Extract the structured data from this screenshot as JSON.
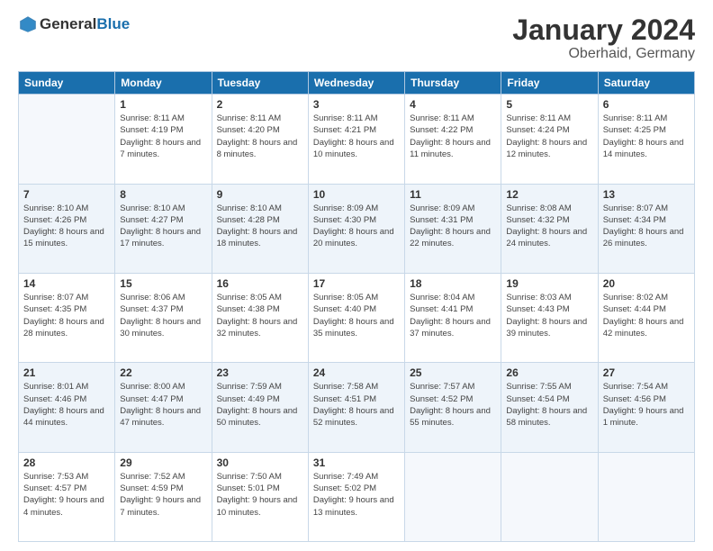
{
  "header": {
    "logo_general": "General",
    "logo_blue": "Blue",
    "title": "January 2024",
    "subtitle": "Oberhaid, Germany"
  },
  "calendar": {
    "days_of_week": [
      "Sunday",
      "Monday",
      "Tuesday",
      "Wednesday",
      "Thursday",
      "Friday",
      "Saturday"
    ],
    "weeks": [
      [
        {
          "num": "",
          "empty": true
        },
        {
          "num": "1",
          "sunrise": "8:11 AM",
          "sunset": "4:19 PM",
          "daylight": "8 hours and 7 minutes."
        },
        {
          "num": "2",
          "sunrise": "8:11 AM",
          "sunset": "4:20 PM",
          "daylight": "8 hours and 8 minutes."
        },
        {
          "num": "3",
          "sunrise": "8:11 AM",
          "sunset": "4:21 PM",
          "daylight": "8 hours and 10 minutes."
        },
        {
          "num": "4",
          "sunrise": "8:11 AM",
          "sunset": "4:22 PM",
          "daylight": "8 hours and 11 minutes."
        },
        {
          "num": "5",
          "sunrise": "8:11 AM",
          "sunset": "4:24 PM",
          "daylight": "8 hours and 12 minutes."
        },
        {
          "num": "6",
          "sunrise": "8:11 AM",
          "sunset": "4:25 PM",
          "daylight": "8 hours and 14 minutes."
        }
      ],
      [
        {
          "num": "7",
          "sunrise": "8:10 AM",
          "sunset": "4:26 PM",
          "daylight": "8 hours and 15 minutes."
        },
        {
          "num": "8",
          "sunrise": "8:10 AM",
          "sunset": "4:27 PM",
          "daylight": "8 hours and 17 minutes."
        },
        {
          "num": "9",
          "sunrise": "8:10 AM",
          "sunset": "4:28 PM",
          "daylight": "8 hours and 18 minutes."
        },
        {
          "num": "10",
          "sunrise": "8:09 AM",
          "sunset": "4:30 PM",
          "daylight": "8 hours and 20 minutes."
        },
        {
          "num": "11",
          "sunrise": "8:09 AM",
          "sunset": "4:31 PM",
          "daylight": "8 hours and 22 minutes."
        },
        {
          "num": "12",
          "sunrise": "8:08 AM",
          "sunset": "4:32 PM",
          "daylight": "8 hours and 24 minutes."
        },
        {
          "num": "13",
          "sunrise": "8:07 AM",
          "sunset": "4:34 PM",
          "daylight": "8 hours and 26 minutes."
        }
      ],
      [
        {
          "num": "14",
          "sunrise": "8:07 AM",
          "sunset": "4:35 PM",
          "daylight": "8 hours and 28 minutes."
        },
        {
          "num": "15",
          "sunrise": "8:06 AM",
          "sunset": "4:37 PM",
          "daylight": "8 hours and 30 minutes."
        },
        {
          "num": "16",
          "sunrise": "8:05 AM",
          "sunset": "4:38 PM",
          "daylight": "8 hours and 32 minutes."
        },
        {
          "num": "17",
          "sunrise": "8:05 AM",
          "sunset": "4:40 PM",
          "daylight": "8 hours and 35 minutes."
        },
        {
          "num": "18",
          "sunrise": "8:04 AM",
          "sunset": "4:41 PM",
          "daylight": "8 hours and 37 minutes."
        },
        {
          "num": "19",
          "sunrise": "8:03 AM",
          "sunset": "4:43 PM",
          "daylight": "8 hours and 39 minutes."
        },
        {
          "num": "20",
          "sunrise": "8:02 AM",
          "sunset": "4:44 PM",
          "daylight": "8 hours and 42 minutes."
        }
      ],
      [
        {
          "num": "21",
          "sunrise": "8:01 AM",
          "sunset": "4:46 PM",
          "daylight": "8 hours and 44 minutes."
        },
        {
          "num": "22",
          "sunrise": "8:00 AM",
          "sunset": "4:47 PM",
          "daylight": "8 hours and 47 minutes."
        },
        {
          "num": "23",
          "sunrise": "7:59 AM",
          "sunset": "4:49 PM",
          "daylight": "8 hours and 50 minutes."
        },
        {
          "num": "24",
          "sunrise": "7:58 AM",
          "sunset": "4:51 PM",
          "daylight": "8 hours and 52 minutes."
        },
        {
          "num": "25",
          "sunrise": "7:57 AM",
          "sunset": "4:52 PM",
          "daylight": "8 hours and 55 minutes."
        },
        {
          "num": "26",
          "sunrise": "7:55 AM",
          "sunset": "4:54 PM",
          "daylight": "8 hours and 58 minutes."
        },
        {
          "num": "27",
          "sunrise": "7:54 AM",
          "sunset": "4:56 PM",
          "daylight": "9 hours and 1 minute."
        }
      ],
      [
        {
          "num": "28",
          "sunrise": "7:53 AM",
          "sunset": "4:57 PM",
          "daylight": "9 hours and 4 minutes."
        },
        {
          "num": "29",
          "sunrise": "7:52 AM",
          "sunset": "4:59 PM",
          "daylight": "9 hours and 7 minutes."
        },
        {
          "num": "30",
          "sunrise": "7:50 AM",
          "sunset": "5:01 PM",
          "daylight": "9 hours and 10 minutes."
        },
        {
          "num": "31",
          "sunrise": "7:49 AM",
          "sunset": "5:02 PM",
          "daylight": "9 hours and 13 minutes."
        },
        {
          "num": "",
          "empty": true
        },
        {
          "num": "",
          "empty": true
        },
        {
          "num": "",
          "empty": true
        }
      ]
    ]
  }
}
